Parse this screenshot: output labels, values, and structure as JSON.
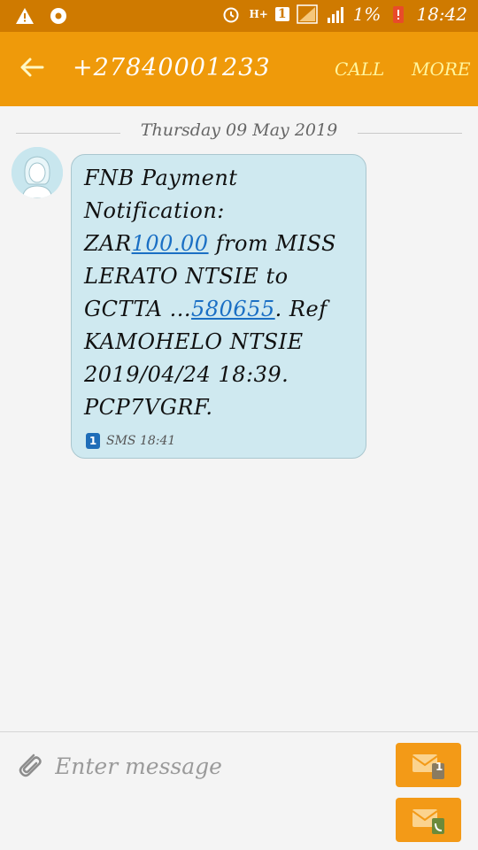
{
  "status_bar": {
    "network_label": "H+",
    "sim_label": "1",
    "battery_percent": "1%",
    "time": "18:42",
    "icons": [
      "warning-icon",
      "settings-icon",
      "alarm-icon",
      "signal-icon",
      "battery-icon"
    ]
  },
  "app_bar": {
    "back_icon": "arrow-left-icon",
    "title": "+27840001233",
    "call_label": "CALL",
    "more_label": "MORE"
  },
  "conversation": {
    "date": "Thursday 09 May 2019",
    "message": {
      "line1": "FNB Payment",
      "line2": "Notification:",
      "line3_prefix": "ZAR",
      "line3_link": "100.00",
      "line3_suffix": " from MISS",
      "line4": "LERATO NTSIE  to",
      "line5_prefix": "GCTTA ...",
      "line5_link": "580655",
      "line5_suffix": ". Ref",
      "line6": "KAMOHELO NTSIE",
      "line7": "2019/04/24 18:39.",
      "line8": "PCP7VGRF.",
      "sim": "1",
      "meta": "SMS 18:41"
    }
  },
  "composer": {
    "placeholder": "Enter message",
    "send_sim1_badge": "1",
    "colors": {
      "accent": "#ef9a0a",
      "bubble": "#cfe9f0",
      "link": "#1a6fc4"
    }
  }
}
